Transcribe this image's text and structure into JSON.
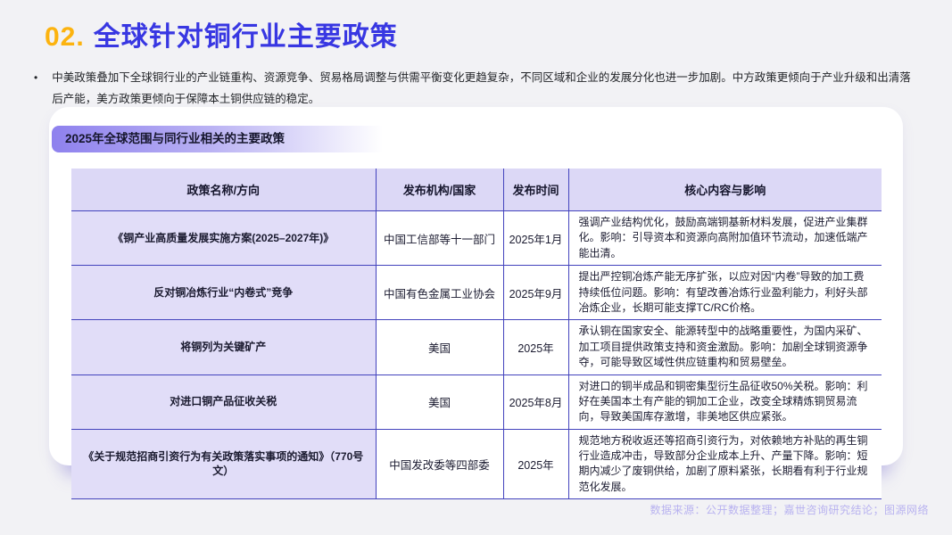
{
  "page": {
    "background": "#f2f2f5",
    "accent_yellow": "#fcb30f",
    "accent_blue": "#3837e2",
    "table_border_color": "#4343bd",
    "header_fill": "#dcd8f6",
    "first_column_fill": "#e1ddf8"
  },
  "header": {
    "number": "02.",
    "title": "全球针对铜行业主要政策"
  },
  "intro": {
    "bullet": "•",
    "text": "中美政策叠加下全球铜行业的产业链重构、资源竞争、贸易格局调整与供需平衡变化更趋复杂，不同区域和企业的发展分化也进一步加剧。中方政策更倾向于产业升级和出清落后产能，美方政策更倾向于保障本土铜供应链的稳定。"
  },
  "card": {
    "badge": "2025年全球范围与同行业相关的主要政策",
    "table": {
      "columns": [
        "政策名称/方向",
        "发布机构/国家",
        "发布时间",
        "核心内容与影响"
      ],
      "rows": [
        {
          "name": "《铜产业高质量发展实施方案(2025–2027年)》",
          "org": "中国工信部等十一部门",
          "date": "2025年1月",
          "impact": "强调产业结构优化，鼓励高端铜基新材料发展，促进产业集群化。影响：引导资本和资源向高附加值环节流动，加速低端产能出清。"
        },
        {
          "name": "反对铜冶炼行业“内卷式”竞争",
          "org": "中国有色金属工业协会",
          "date": "2025年9月",
          "impact": "提出严控铜冶炼产能无序扩张，以应对因“内卷”导致的加工费持续低位问题。影响：有望改善冶炼行业盈利能力，利好头部冶炼企业，长期可能支撑TC/RC价格。"
        },
        {
          "name": "将铜列为关键矿产",
          "org": "美国",
          "date": "2025年",
          "impact": "承认铜在国家安全、能源转型中的战略重要性，为国内采矿、加工项目提供政策支持和资金激励。影响：加剧全球铜资源争夺，可能导致区域性供应链重构和贸易壁垒。"
        },
        {
          "name": "对进口铜产品征收关税",
          "org": "美国",
          "date": "2025年8月",
          "impact": "对进口的铜半成品和铜密集型衍生品征收50%关税。影响：利好在美国本土有产能的铜加工企业，改变全球精炼铜贸易流向，导致美国库存激增，非美地区供应紧张。"
        },
        {
          "name": "《关于规范招商引资行为有关政策落实事项的通知》（770号文）",
          "org": "中国发改委等四部委",
          "date": "2025年",
          "impact": "规范地方税收返还等招商引资行为，对依赖地方补贴的再生铜行业造成冲击，导致部分企业成本上升、产量下降。影响：短期内减少了废铜供给，加剧了原料紧张，长期看有利于行业规范化发展。"
        }
      ]
    }
  },
  "footer": {
    "source": "数据来源：公开数据整理；嘉世咨询研究结论；图源网络"
  }
}
